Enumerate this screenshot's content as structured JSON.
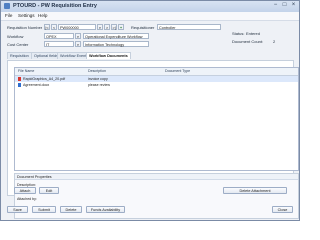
{
  "window": {
    "title": "PTOURD - PW Requisition Entry",
    "menu": [
      "File",
      "Settings",
      "Help"
    ]
  },
  "form": {
    "requisition_number_label": "Requisition Number",
    "requisition_number_value": "PW000000",
    "requisitioner_label": "Requisitioner",
    "requisitioner_value": "Controller",
    "workflow_label": "Workflow",
    "workflow_code": "OPEX",
    "workflow_desc": "Operational Expenditure Workflow",
    "cost_center_label": "Cost Center",
    "cost_center_code": "IT",
    "cost_center_desc": "Information Technology",
    "status_label": "Status:",
    "status_value": "Entered",
    "document_count_label": "Document Count:",
    "document_count_value": "2"
  },
  "tabs": [
    {
      "label": "Requisition",
      "active": false
    },
    {
      "label": "Optional fields",
      "active": false
    },
    {
      "label": "Workflow Events",
      "active": false
    },
    {
      "label": "Workflow Documents",
      "active": true
    }
  ],
  "grid": {
    "columns": [
      "File Name",
      "Description",
      "Document Type"
    ],
    "rows": [
      {
        "file": "RapidGraphics_A4_20.pdf",
        "description": "invoice copy",
        "type": "",
        "icon": "pdf-icon"
      },
      {
        "file": "Agreement.docx",
        "description": "please review",
        "type": "",
        "icon": "word-document-icon"
      }
    ]
  },
  "properties": {
    "header": "Document Properties",
    "description_label": "Description:",
    "path_label": "Path:",
    "attached_by_label": "Attached by:"
  },
  "panel_buttons": {
    "attach": "Attach",
    "edit": "Edit",
    "delete_attachment": "Delete Attachment"
  },
  "footer": {
    "save": "Save",
    "submit": "Submit",
    "delete": "Delete",
    "funds_availability": "Funds Availability",
    "close": "Close"
  }
}
